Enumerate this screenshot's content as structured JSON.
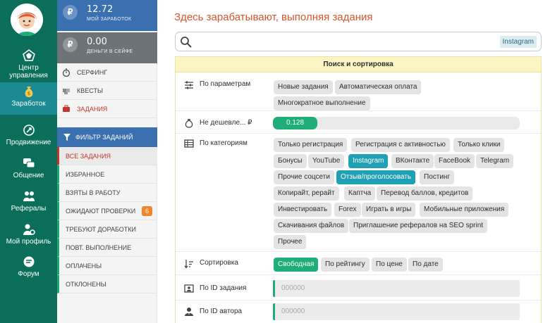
{
  "sidebar": {
    "items": [
      {
        "label": "Центр управления",
        "icon": "dashboard-icon"
      },
      {
        "label": "Заработок",
        "icon": "money-bag-icon"
      },
      {
        "label": "Продвижение",
        "icon": "rocket-icon"
      },
      {
        "label": "Общение",
        "icon": "chat-icon"
      },
      {
        "label": "Рефералы",
        "icon": "users-icon"
      },
      {
        "label": "Мой профиль",
        "icon": "profile-gear-icon"
      },
      {
        "label": "Форум",
        "icon": "forum-icon"
      }
    ]
  },
  "balances": [
    {
      "value": "12.72",
      "label": "МОЙ ЗАРАБОТОК",
      "currency": "₽"
    },
    {
      "value": "0.00",
      "label": "ДЕНЬГИ В СЕЙФЕ",
      "currency": "₽"
    }
  ],
  "earn_menu": [
    {
      "label": "СЕРФИНГ",
      "icon": "stopwatch-icon"
    },
    {
      "label": "КВЕСТЫ",
      "icon": "puzzle-icon"
    },
    {
      "label": "ЗАДАНИЯ",
      "icon": "briefcase-icon"
    }
  ],
  "filter": {
    "title": "ФИЛЬТР ЗАДАНИЙ",
    "items": [
      {
        "label": "ВСЕ ЗАДАНИЯ"
      },
      {
        "label": "ИЗБРАННОЕ"
      },
      {
        "label": "ВЗЯТЫ В РАБОТУ"
      },
      {
        "label": "ОЖИДАЮТ ПРОВЕРКИ",
        "badge": "6"
      },
      {
        "label": "ТРЕБУЮТ ДОРАБОТКИ"
      },
      {
        "label": "ПОВТ. ВЫПОЛНЕНИЕ"
      },
      {
        "label": "ОПЛАЧЕНЫ"
      },
      {
        "label": "ОТКЛОНЕНЫ"
      }
    ]
  },
  "main": {
    "title": "Здесь зарабатывают, выполняя задания",
    "search": {
      "value": "",
      "placeholder": "",
      "tag": "Instagram"
    },
    "panel_title": "Поиск и сортировка",
    "params": {
      "label": "По параметрам",
      "chips": [
        "Новые задания",
        "Автоматическая оплата",
        "Многократное выполнение"
      ]
    },
    "price": {
      "label": "Не дешевле... ₽",
      "value": "0.128",
      "fill_fraction": 0.18
    },
    "categories": {
      "label": "По категориям",
      "chips": [
        "Только регистрация",
        "Регистрация с активностью",
        "Только клики",
        "Бонусы",
        "YouTube",
        "Instagram",
        "ВКонтакте",
        "FaceBook",
        "Telegram",
        "Прочие соцсети",
        "Отзыв/проголосовать",
        "Постинг",
        "Копирайт, рерайт",
        "Каптча",
        "Перевод баллов, кредитов",
        "Инвестировать",
        "Forex",
        "Играть в игры",
        "Мобильные приложения",
        "Скачивания файлов",
        "Приглашение рефералов на SEO sprint",
        "Прочее"
      ],
      "selected": [
        "Instagram",
        "Отзыв/проголосовать"
      ]
    },
    "sort": {
      "label": "Сортировка",
      "options": [
        "Свободная",
        "По рейтингу",
        "По цене",
        "По дате"
      ],
      "selected": "Свободная"
    },
    "task_id": {
      "label": "По ID задания",
      "placeholder": "000000"
    },
    "author_id": {
      "label": "По ID автора",
      "placeholder": "000000"
    }
  },
  "colors": {
    "nav_bg": "#0a6e5a",
    "nav_active": "#1b8a93",
    "balance_blue": "#3a6fb0",
    "balance_gray": "#6d7377",
    "accent_orange": "#d9562d",
    "chip_selected": "#1fa0b5",
    "green": "#1fae7a",
    "badge_orange": "#f0862a"
  }
}
